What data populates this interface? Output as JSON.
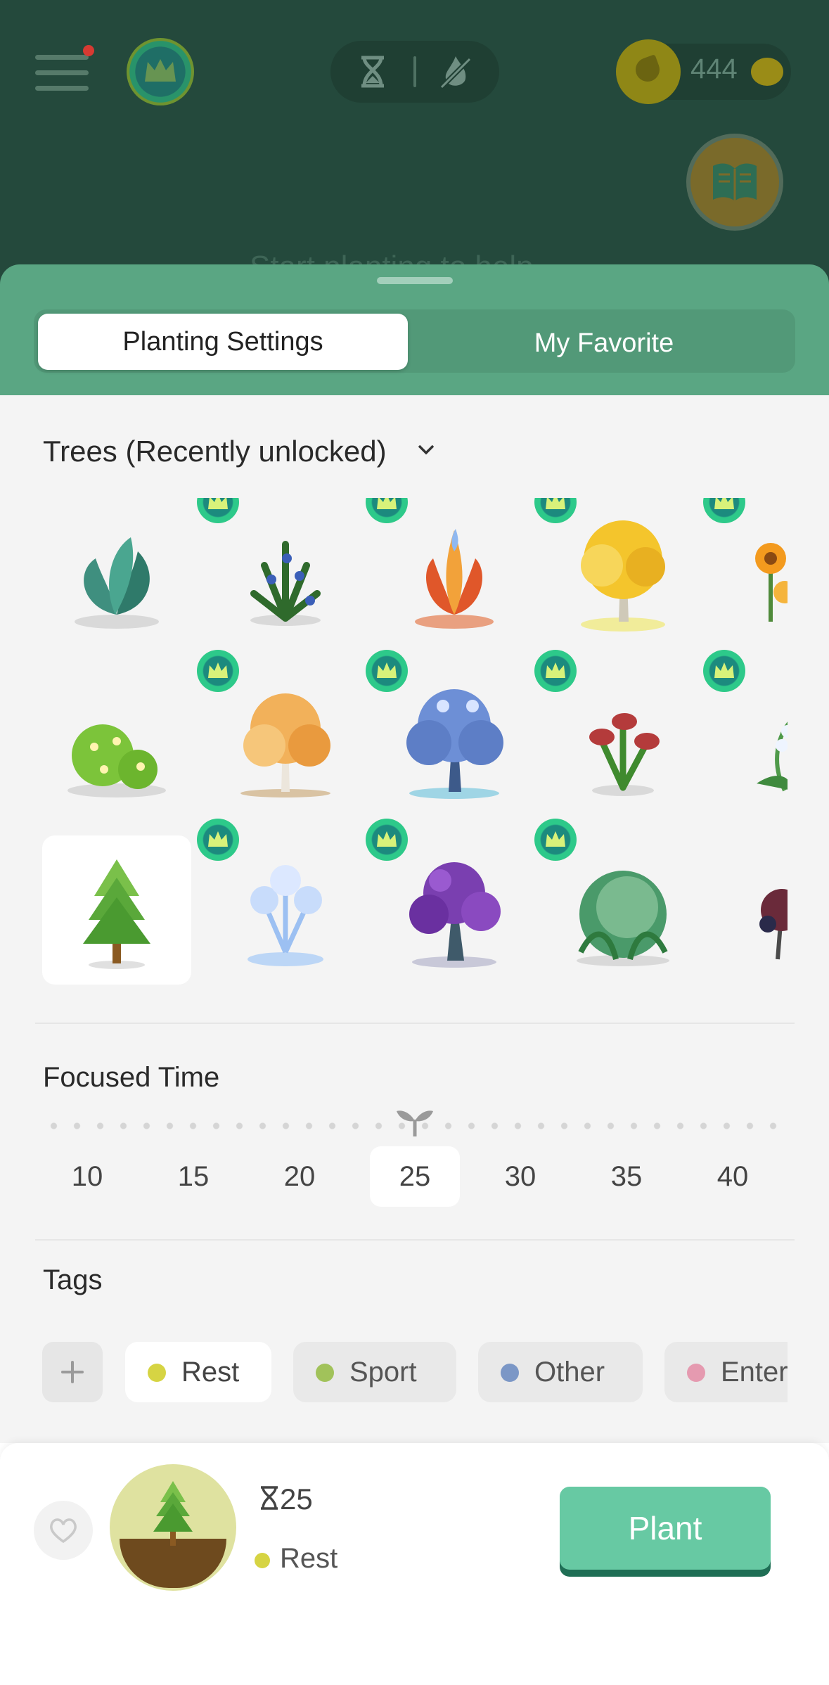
{
  "header": {
    "coins": "444",
    "hidden_message": "Start planting to help"
  },
  "tabs": {
    "planting_settings": "Planting Settings",
    "my_favorite": "My Favorite"
  },
  "trees": {
    "title": "Trees (Recently unlocked)"
  },
  "focus": {
    "title": "Focused Time",
    "options": [
      "10",
      "15",
      "20",
      "25",
      "30",
      "35",
      "40"
    ],
    "selected": "25"
  },
  "tags": {
    "title": "Tags",
    "items": [
      {
        "label": "Rest",
        "color": "#d6d443",
        "selected": true
      },
      {
        "label": "Sport",
        "color": "#a1c25a"
      },
      {
        "label": "Other",
        "color": "#7b97c6"
      },
      {
        "label": "Enter",
        "color": "#e59ab0"
      }
    ]
  },
  "summary": {
    "time": "25",
    "tag": "Rest"
  },
  "actions": {
    "plant_label": "Plant"
  },
  "colors": {
    "accent": "#67c9a3",
    "header": "#24493c",
    "sheet": "#5aa683"
  }
}
